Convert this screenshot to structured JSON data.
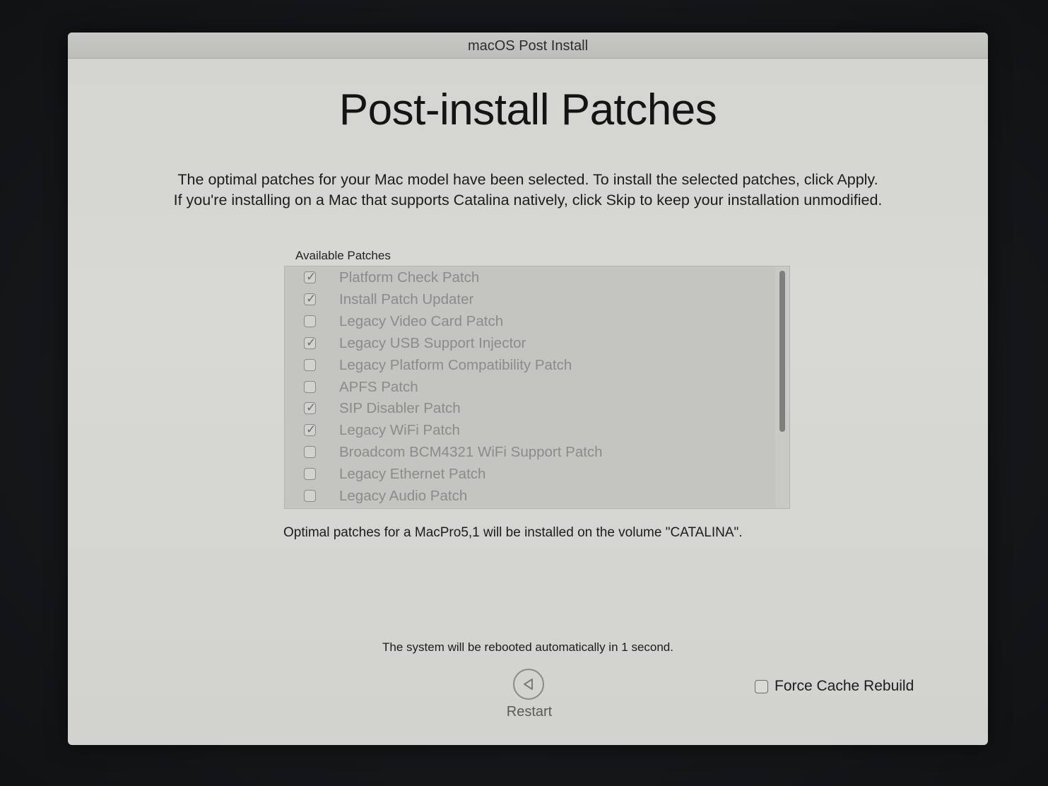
{
  "window": {
    "title": "macOS Post Install"
  },
  "main": {
    "heading": "Post-install Patches",
    "description_line1": "The optimal patches for your Mac model have been selected. To install the selected patches, click Apply.",
    "description_line2": "If you're installing on a Mac that supports Catalina natively, click Skip to keep your installation unmodified.",
    "list_caption": "Available Patches",
    "volume_note": "Optimal patches for a MacPro5,1 will be installed on the volume \"CATALINA\".",
    "reboot_note": "The system will be rebooted automatically in 1 second."
  },
  "patches": [
    {
      "label": "Platform Check Patch",
      "checked": true
    },
    {
      "label": "Install Patch Updater",
      "checked": true
    },
    {
      "label": "Legacy Video Card Patch",
      "checked": false
    },
    {
      "label": "Legacy USB Support Injector",
      "checked": true
    },
    {
      "label": "Legacy Platform Compatibility Patch",
      "checked": false
    },
    {
      "label": "APFS Patch",
      "checked": false
    },
    {
      "label": "SIP Disabler Patch",
      "checked": true
    },
    {
      "label": "Legacy WiFi Patch",
      "checked": true
    },
    {
      "label": "Broadcom BCM4321 WiFi Support Patch",
      "checked": false
    },
    {
      "label": "Legacy Ethernet Patch",
      "checked": false
    },
    {
      "label": "Legacy Audio Patch",
      "checked": false
    }
  ],
  "footer": {
    "restart_label": "Restart",
    "restart_icon": "back-arrow-icon",
    "force_cache_label": "Force Cache Rebuild",
    "force_cache_checked": false
  },
  "colors": {
    "window_bg": "#d4d4d0",
    "list_bg": "#c4c4c1",
    "disabled_text": "#8b8b89",
    "text": "#1c1c1c"
  }
}
